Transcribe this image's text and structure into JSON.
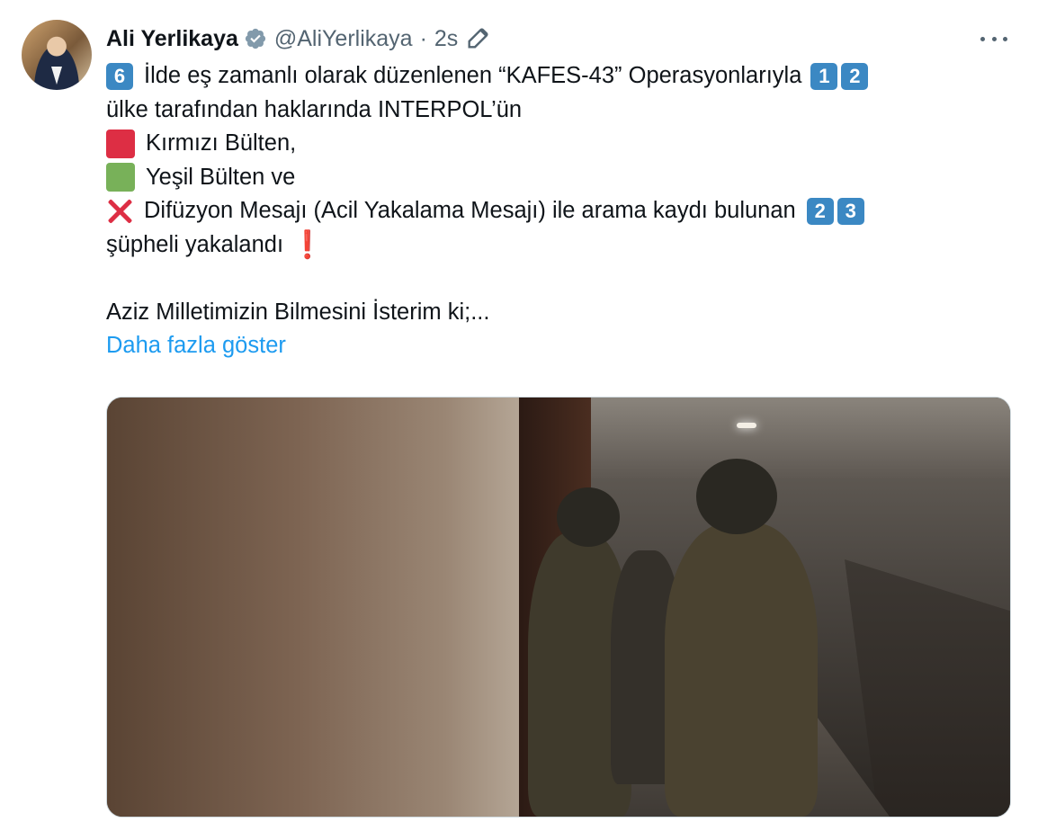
{
  "tweet": {
    "author_name": "Ali Yerlikaya",
    "handle": "@AliYerlikaya",
    "dot": "·",
    "time": "2s",
    "verified_icon": "verified-badge-icon",
    "edit_icon": "edit-icon",
    "more_icon": "more-options-icon",
    "colors": {
      "link": "#1d9bf0",
      "text": "#0f1419",
      "secondary": "#536471",
      "keycap": "#3b88c3",
      "red_square": "#dd2e44",
      "green_square": "#78b159"
    },
    "body": {
      "line1": {
        "keycap1": "6",
        "text": "İlde eş zamanlı olarak düzenlenen “KAFES-43” Operasyonlarıyla",
        "keycap2": "1",
        "keycap3": "2"
      },
      "line2": "ülke tarafından haklarında INTERPOL’ün",
      "line3": "Kırmızı Bülten,",
      "line4": "Yeşil Bülten ve",
      "line5": {
        "text": "Difüzyon Mesajı (Acil Yakalama Mesajı) ile arama kaydı bulunan",
        "keycap1": "2",
        "keycap2": "3"
      },
      "line6": {
        "text": "şüpheli yakalandı",
        "emoji": "❗"
      },
      "line7": "Aziz Milletimizin Bilmesini İsterim ki;...",
      "show_more": "Daha fazla göster"
    },
    "media": {
      "kind": "video-thumbnail"
    }
  }
}
